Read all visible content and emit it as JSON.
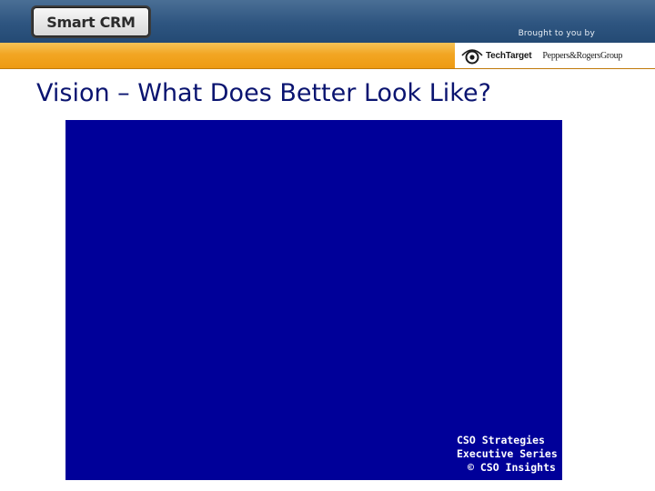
{
  "header": {
    "logo_text": "Smart CRM",
    "brought_by": "Brought to you by",
    "sponsors": {
      "primary": "TechTarget",
      "secondary": "Peppers&RogersGroup"
    }
  },
  "slide": {
    "title": "Vision – What Does Better Look Like?"
  },
  "panel": {
    "footer_lines": [
      "CSO Strategies",
      "Executive Series",
      "© CSO Insights"
    ]
  },
  "colors": {
    "header_blue": "#2e5580",
    "stripe_orange": "#f2a623",
    "title_text": "#0a1470",
    "panel_blue": "#000099"
  }
}
